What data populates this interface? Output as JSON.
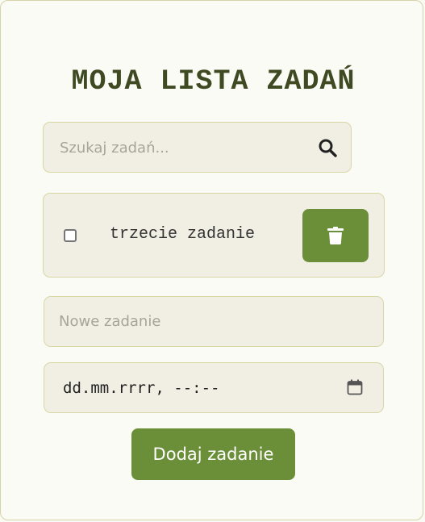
{
  "header": {
    "title": "MOJA LISTA ZADAŃ"
  },
  "search": {
    "placeholder": "Szukaj zadań...",
    "value": "",
    "icon": "search-icon"
  },
  "tasks": [
    {
      "text": "trzecie zadanie",
      "completed": false,
      "delete_icon": "trash-icon"
    }
  ],
  "form": {
    "task_placeholder": "Nowe zadanie",
    "task_value": "",
    "datetime_display": "dd.mm.rrrr, --:--",
    "calendar_icon": "calendar-icon",
    "submit_label": "Dodaj zadanie"
  },
  "colors": {
    "accent": "#6b8e38",
    "title": "#3f4a23",
    "field_background": "#f1efe4",
    "field_border": "#d9d6a6",
    "page_background": "#fbfbf5"
  }
}
